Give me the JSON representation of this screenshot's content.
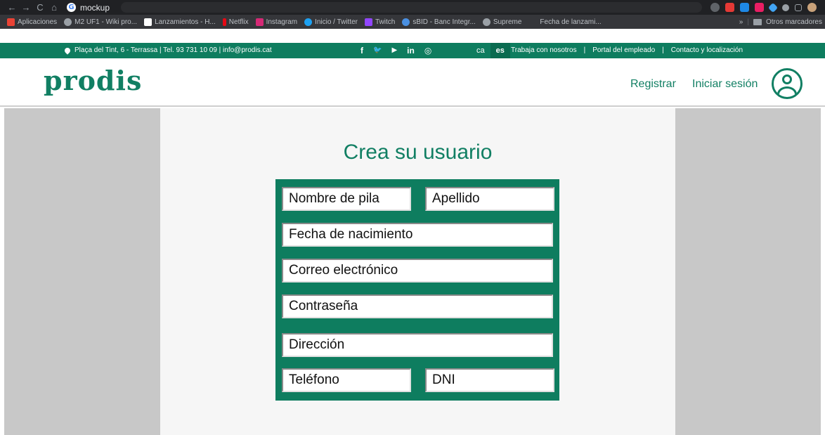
{
  "browser": {
    "nav": {
      "back": "←",
      "forward": "→",
      "reload": "C",
      "home": "⌂"
    },
    "tab_title": "mockup",
    "bookmarks": [
      "Aplicaciones",
      "M2 UF1 - Wiki pro...",
      "Lanzamientos - H...",
      "Netflix",
      "Instagram",
      "Inicio / Twitter",
      "Twitch",
      "sBID - Banc Integr...",
      "Supreme",
      "Fecha de lanzami..."
    ],
    "more_bookmarks": "»",
    "other_bookmarks": "Otros marcadores"
  },
  "infobar": {
    "address": "Plaça del Tint, 6 - Terrassa | Tel. 93 731 10 09 | info@prodis.cat",
    "social": {
      "facebook": "f",
      "twitter": "🐦",
      "youtube": "▶",
      "linkedin": "in",
      "instagram": "◎"
    },
    "lang": {
      "ca": "ca",
      "es": "es"
    },
    "links": [
      "Trabaja con nosotros",
      "Portal del empleado",
      "Contacto y localización"
    ],
    "separator": "|"
  },
  "header": {
    "logo": "prodis",
    "register": "Registrar",
    "login": "Iniciar sesión"
  },
  "form": {
    "title": "Crea su usuario",
    "first_name": "Nombre de pila",
    "last_name": "Apellido",
    "birth_date": "Fecha de nacimiento",
    "email": "Correo electrónico",
    "password": "Contraseña",
    "address": "Dirección",
    "phone": "Teléfono",
    "dni": "DNI"
  },
  "colors": {
    "brand_green": "#0e7d5f",
    "side_gray": "#c8c8c8",
    "panel_bg": "#f6f6f6"
  }
}
